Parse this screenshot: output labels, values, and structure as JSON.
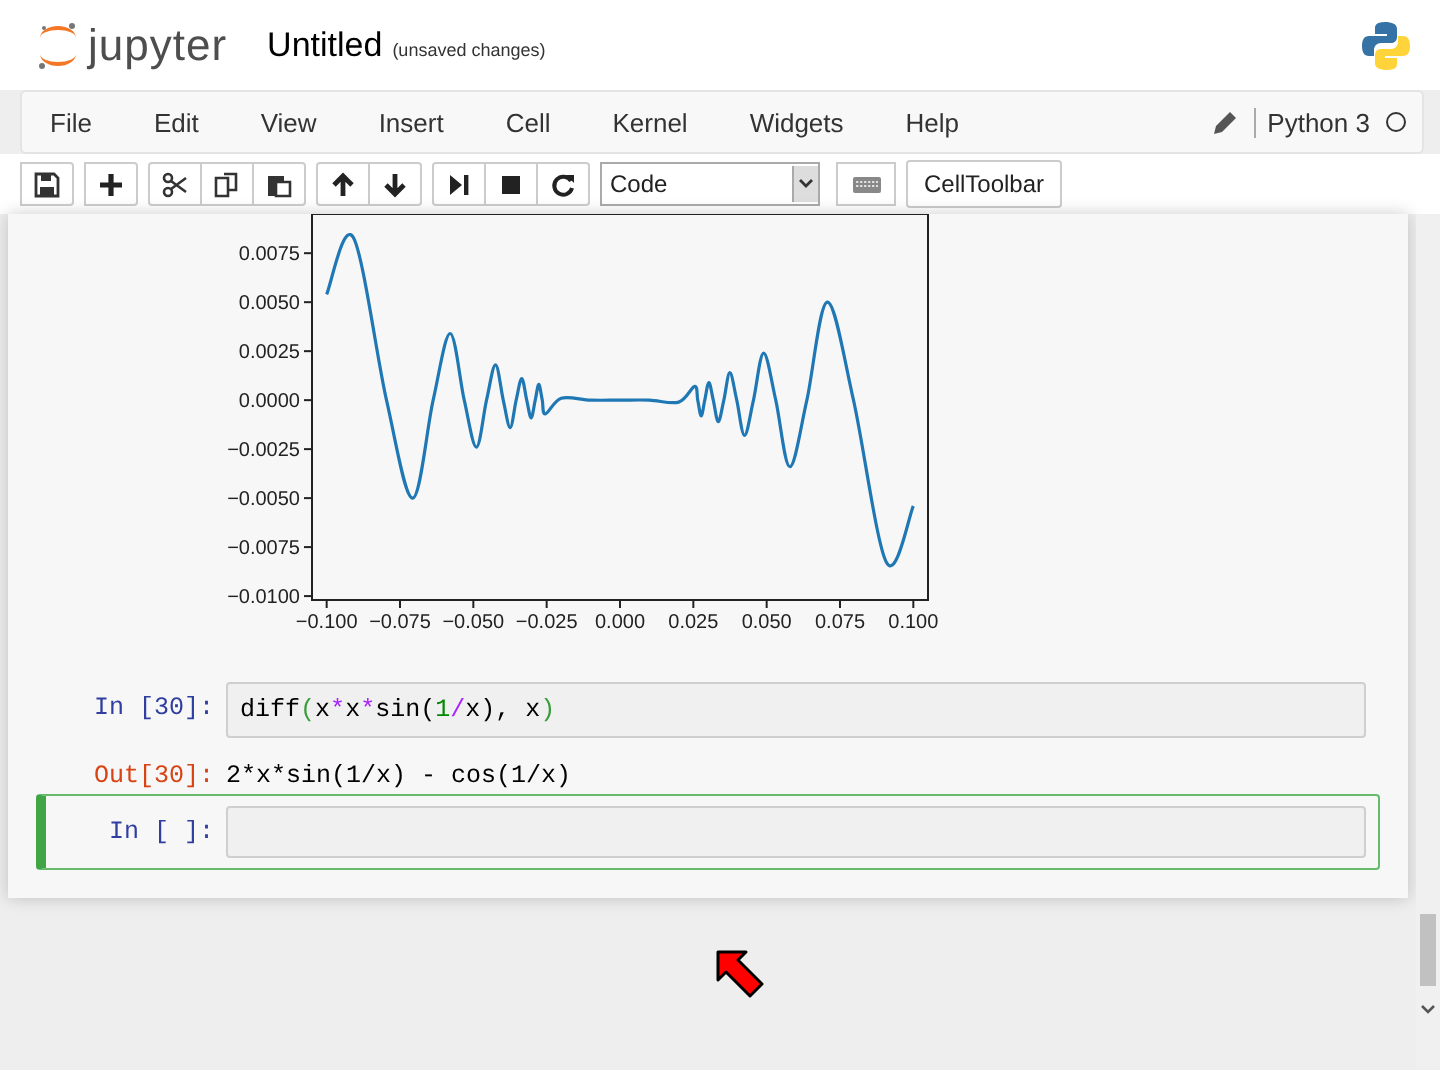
{
  "header": {
    "brand": "jupyter",
    "title": "Untitled",
    "save_status": "(unsaved changes)"
  },
  "menu": {
    "items": [
      "File",
      "Edit",
      "View",
      "Insert",
      "Cell",
      "Kernel",
      "Widgets",
      "Help"
    ],
    "kernel_name": "Python 3"
  },
  "toolbar": {
    "groups": [
      {
        "buttons": [
          {
            "kind": "save"
          }
        ]
      },
      {
        "buttons": [
          {
            "kind": "add"
          }
        ]
      },
      {
        "buttons": [
          {
            "kind": "cut"
          },
          {
            "kind": "copy"
          },
          {
            "kind": "paste"
          }
        ]
      },
      {
        "buttons": [
          {
            "kind": "up"
          },
          {
            "kind": "down"
          }
        ]
      },
      {
        "buttons": [
          {
            "kind": "run"
          },
          {
            "kind": "stop"
          },
          {
            "kind": "restart"
          }
        ]
      }
    ],
    "cell_type": "Code",
    "cell_toolbar": "CellToolbar"
  },
  "notebook": {
    "plot": {
      "chart_data": {
        "type": "line",
        "xlim": [
          -0.105,
          0.105
        ],
        "ylim": [
          -0.0102,
          0.0095
        ],
        "xticks": [
          {
            "value": -0.1,
            "label": "−0.100"
          },
          {
            "value": -0.075,
            "label": "−0.075"
          },
          {
            "value": -0.05,
            "label": "−0.050"
          },
          {
            "value": -0.025,
            "label": "−0.025"
          },
          {
            "value": 0,
            "label": "0.000"
          },
          {
            "value": 0.025,
            "label": "0.025"
          },
          {
            "value": 0.05,
            "label": "0.050"
          },
          {
            "value": 0.075,
            "label": "0.075"
          },
          {
            "value": 0.1,
            "label": "0.100"
          }
        ],
        "yticks": [
          {
            "value": 0.0075,
            "label": "0.0075"
          },
          {
            "value": 0.005,
            "label": "0.0050"
          },
          {
            "value": 0.0025,
            "label": "0.0025"
          },
          {
            "value": 0,
            "label": "0.0000"
          },
          {
            "value": -0.0025,
            "label": "−0.0025"
          },
          {
            "value": -0.005,
            "label": "−0.0050"
          },
          {
            "value": -0.0075,
            "label": "−0.0075"
          },
          {
            "value": -0.01,
            "label": "−0.0100"
          }
        ],
        "x": [
          -0.1,
          -0.0909,
          -0.0796,
          -0.0707,
          -0.0637,
          -0.0579,
          -0.0531,
          -0.04897,
          -0.0455,
          -0.04244,
          -0.0398,
          -0.03745,
          -0.0354,
          -0.0335,
          -0.0318,
          -0.0303,
          -0.0289,
          -0.02768,
          -0.0265,
          -0.02546,
          -0.02,
          -0.01,
          0,
          0.01,
          0.02,
          0.02546,
          0.0265,
          0.02768,
          0.0289,
          0.0303,
          0.0318,
          0.0335,
          0.0354,
          0.03745,
          0.0398,
          0.04244,
          0.0455,
          0.04897,
          0.0531,
          0.0579,
          0.0637,
          0.0707,
          0.0796,
          0.0909,
          0.1
        ],
        "series": [
          {
            "color": "#1f77b4",
            "values": [
              0.0054,
              0.0083,
              0,
              -0.005,
              0,
              0.0034,
              0,
              -0.0024,
              0,
              0.0018,
              0,
              -0.0014,
              0,
              0.0011,
              0,
              -0.0009,
              0,
              0.0008,
              0,
              -0.0007,
              0.0001,
              0,
              0,
              0,
              -0.0001,
              0.0007,
              0,
              -0.0008,
              0,
              0.0009,
              0,
              -0.0011,
              0,
              0.0014,
              0,
              -0.0018,
              0,
              0.0024,
              0,
              -0.0034,
              0,
              0.005,
              0,
              -0.0083,
              -0.0054
            ]
          }
        ]
      }
    },
    "cells": [
      {
        "kind": "code",
        "prompt": "In [30]:",
        "selected": false,
        "tokens": [
          {
            "text": "diff",
            "kind": "name"
          },
          {
            "text": "(",
            "kind": "paren"
          },
          {
            "text": "x",
            "kind": "name"
          },
          {
            "text": "*",
            "kind": "operator"
          },
          {
            "text": "x",
            "kind": "name"
          },
          {
            "text": "*",
            "kind": "operator"
          },
          {
            "text": "sin(",
            "kind": "name"
          },
          {
            "text": "1",
            "kind": "number"
          },
          {
            "text": "/",
            "kind": "operator"
          },
          {
            "text": "x), x",
            "kind": "name"
          },
          {
            "text": ")",
            "kind": "paren"
          }
        ],
        "output_prompt": "Out[30]:",
        "output": "2*x*sin(1/x) - cos(1/x)"
      },
      {
        "kind": "code",
        "prompt": "In [ ]:",
        "selected": true
      }
    ]
  }
}
